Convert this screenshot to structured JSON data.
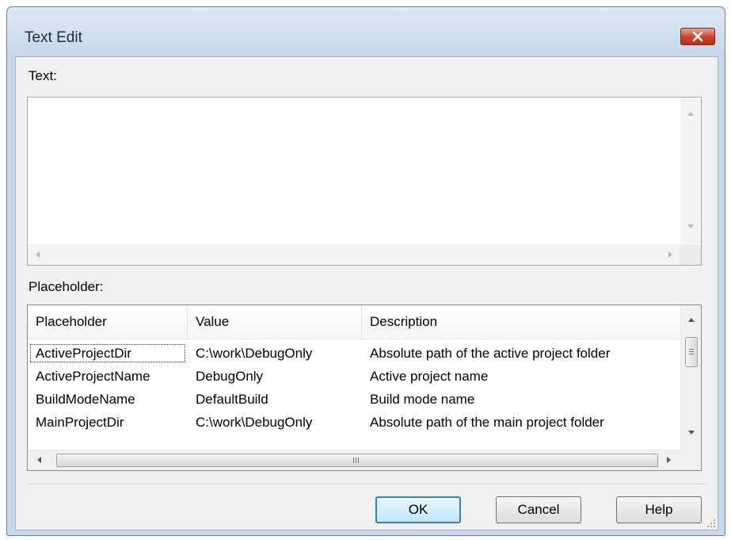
{
  "window": {
    "title": "Text Edit",
    "close_icon": "close-x-icon",
    "accent_close": "#c7442b"
  },
  "text_section": {
    "label": "Text:",
    "value": ""
  },
  "placeholder_section": {
    "label": "Placeholder:",
    "columns": [
      "Placeholder",
      "Value",
      "Description"
    ],
    "rows": [
      {
        "placeholder": "ActiveProjectDir",
        "value": "C:\\work\\DebugOnly",
        "description": "Absolute path of the active project folder"
      },
      {
        "placeholder": "ActiveProjectName",
        "value": "DebugOnly",
        "description": "Active project name"
      },
      {
        "placeholder": "BuildModeName",
        "value": "DefaultBuild",
        "description": "Build mode name"
      },
      {
        "placeholder": "MainProjectDir",
        "value": "C:\\work\\DebugOnly",
        "description": "Absolute path of the main project folder"
      }
    ]
  },
  "buttons": {
    "ok": "OK",
    "cancel": "Cancel",
    "help": "Help"
  }
}
